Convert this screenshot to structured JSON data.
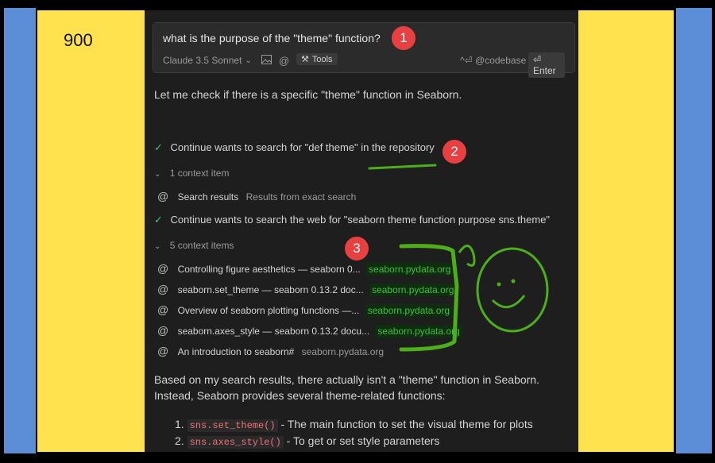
{
  "corner_number": "900",
  "prompt": {
    "text": "what is the purpose of the \"theme\" function?",
    "model": "Claude 3.5 Sonnet",
    "tools_label": "Tools",
    "codebase_label": "^⏎ @codebase",
    "enter_label": "⏎ Enter"
  },
  "response": {
    "intro": "Let me check if there is a specific \"theme\" function in Seaborn.",
    "step1": "Continue wants to search for \"def theme\" in the repository",
    "step1_context": "1 context item",
    "search_results": {
      "title": "Search results",
      "desc": "Results from exact search"
    },
    "step2": "Continue wants to search the web for \"seaborn theme function purpose sns.theme\"",
    "step2_context": "5 context items",
    "items": [
      {
        "title": "Controlling figure aesthetics — seaborn 0...",
        "url": "seaborn.pydata.org"
      },
      {
        "title": "seaborn.set_theme — seaborn 0.13.2 doc...",
        "url": "seaborn.pydata.org"
      },
      {
        "title": "Overview of seaborn plotting functions —...",
        "url": "seaborn.pydata.org"
      },
      {
        "title": "seaborn.axes_style — seaborn 0.13.2 docu...",
        "url": "seaborn.pydata.org"
      },
      {
        "title": "An introduction to seaborn#",
        "url": "seaborn.pydata.org"
      }
    ],
    "summary_1": "Based on my search results, there actually isn't a \"theme\" function in Seaborn.",
    "summary_2": "Instead, Seaborn provides several theme-related functions:",
    "list": [
      {
        "num": "1.",
        "code": "sns.set_theme()",
        "text": " - The main function to set the visual theme for plots"
      },
      {
        "num": "2.",
        "code": "sns.axes_style()",
        "text": " - To get or set style parameters"
      }
    ]
  },
  "badges": [
    "1",
    "2",
    "3"
  ],
  "colors": {
    "panel": "#1e1e1e",
    "yellow": "#ffe24d",
    "blue": "#5b8ed6",
    "badge": "#e84040",
    "marker": "#4caf1a"
  }
}
